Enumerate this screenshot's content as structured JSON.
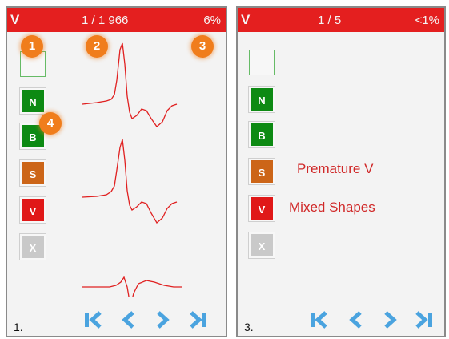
{
  "colors": {
    "header": "#e41f1f",
    "normal": "#0d8a13",
    "supraventricular": "#cc6518",
    "ventricular": "#e01818",
    "unclassified": "#c9c9c9",
    "marker": "#f07d1c",
    "nav": "#4aa3df",
    "ecg_trace": "#e02020"
  },
  "left_panel": {
    "header": {
      "class": "V",
      "count": "1 / 1 966",
      "percent": "6%"
    },
    "markers": [
      "1",
      "2",
      "3",
      "4"
    ],
    "buttons": [
      {
        "label": "",
        "kind": "empty"
      },
      {
        "label": "N",
        "kind": "n"
      },
      {
        "label": "B",
        "kind": "b"
      },
      {
        "label": "S",
        "kind": "s"
      },
      {
        "label": "V",
        "kind": "v"
      },
      {
        "label": "X",
        "kind": "x"
      }
    ],
    "page_number": "1."
  },
  "right_panel": {
    "header": {
      "class": "V",
      "count": "1 / 5",
      "percent": "<1%"
    },
    "buttons": [
      {
        "label": "",
        "kind": "empty"
      },
      {
        "label": "N",
        "kind": "n"
      },
      {
        "label": "B",
        "kind": "b"
      },
      {
        "label": "S",
        "kind": "s"
      },
      {
        "label": "V",
        "kind": "v"
      },
      {
        "label": "X",
        "kind": "x"
      }
    ],
    "labels": {
      "premature": "Premature V",
      "mixed": "Mixed Shapes"
    },
    "page_number": "3."
  },
  "nav_icons": [
    "first-page-icon",
    "previous-icon",
    "next-icon",
    "last-page-icon"
  ]
}
